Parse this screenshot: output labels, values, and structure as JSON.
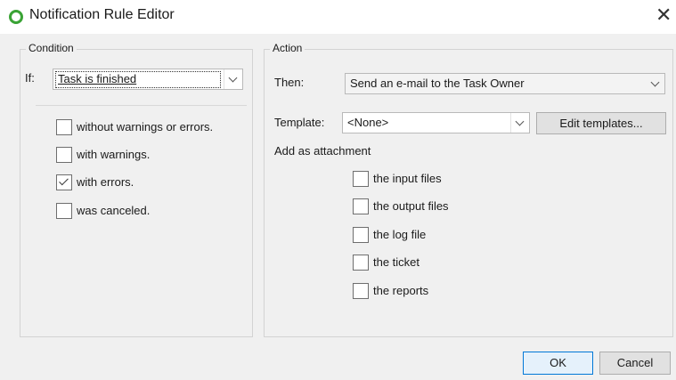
{
  "window": {
    "title": "Notification Rule Editor",
    "close_glyph": "✕",
    "icon": "circle-ring-icon",
    "accent": "#3aa335"
  },
  "condition": {
    "group_title": "Condition",
    "if_label": "If:",
    "if_value": "Task is finished",
    "checkboxes": [
      {
        "label": "without warnings or errors.",
        "checked": false
      },
      {
        "label": "with warnings.",
        "checked": false
      },
      {
        "label": "with errors.",
        "checked": true
      },
      {
        "label": "was canceled.",
        "checked": false
      }
    ]
  },
  "action": {
    "group_title": "Action",
    "then_label": "Then:",
    "then_value": "Send an e-mail to the Task Owner",
    "template_label": "Template:",
    "template_value": "<None>",
    "edit_templates_label": "Edit templates...",
    "attachment_label": "Add as attachment",
    "attachments": [
      {
        "label": "the input files",
        "checked": false
      },
      {
        "label": "the output files",
        "checked": false
      },
      {
        "label": "the log file",
        "checked": false
      },
      {
        "label": "the ticket",
        "checked": false
      },
      {
        "label": "the reports",
        "checked": false
      }
    ]
  },
  "buttons": {
    "ok": "OK",
    "cancel": "Cancel"
  }
}
